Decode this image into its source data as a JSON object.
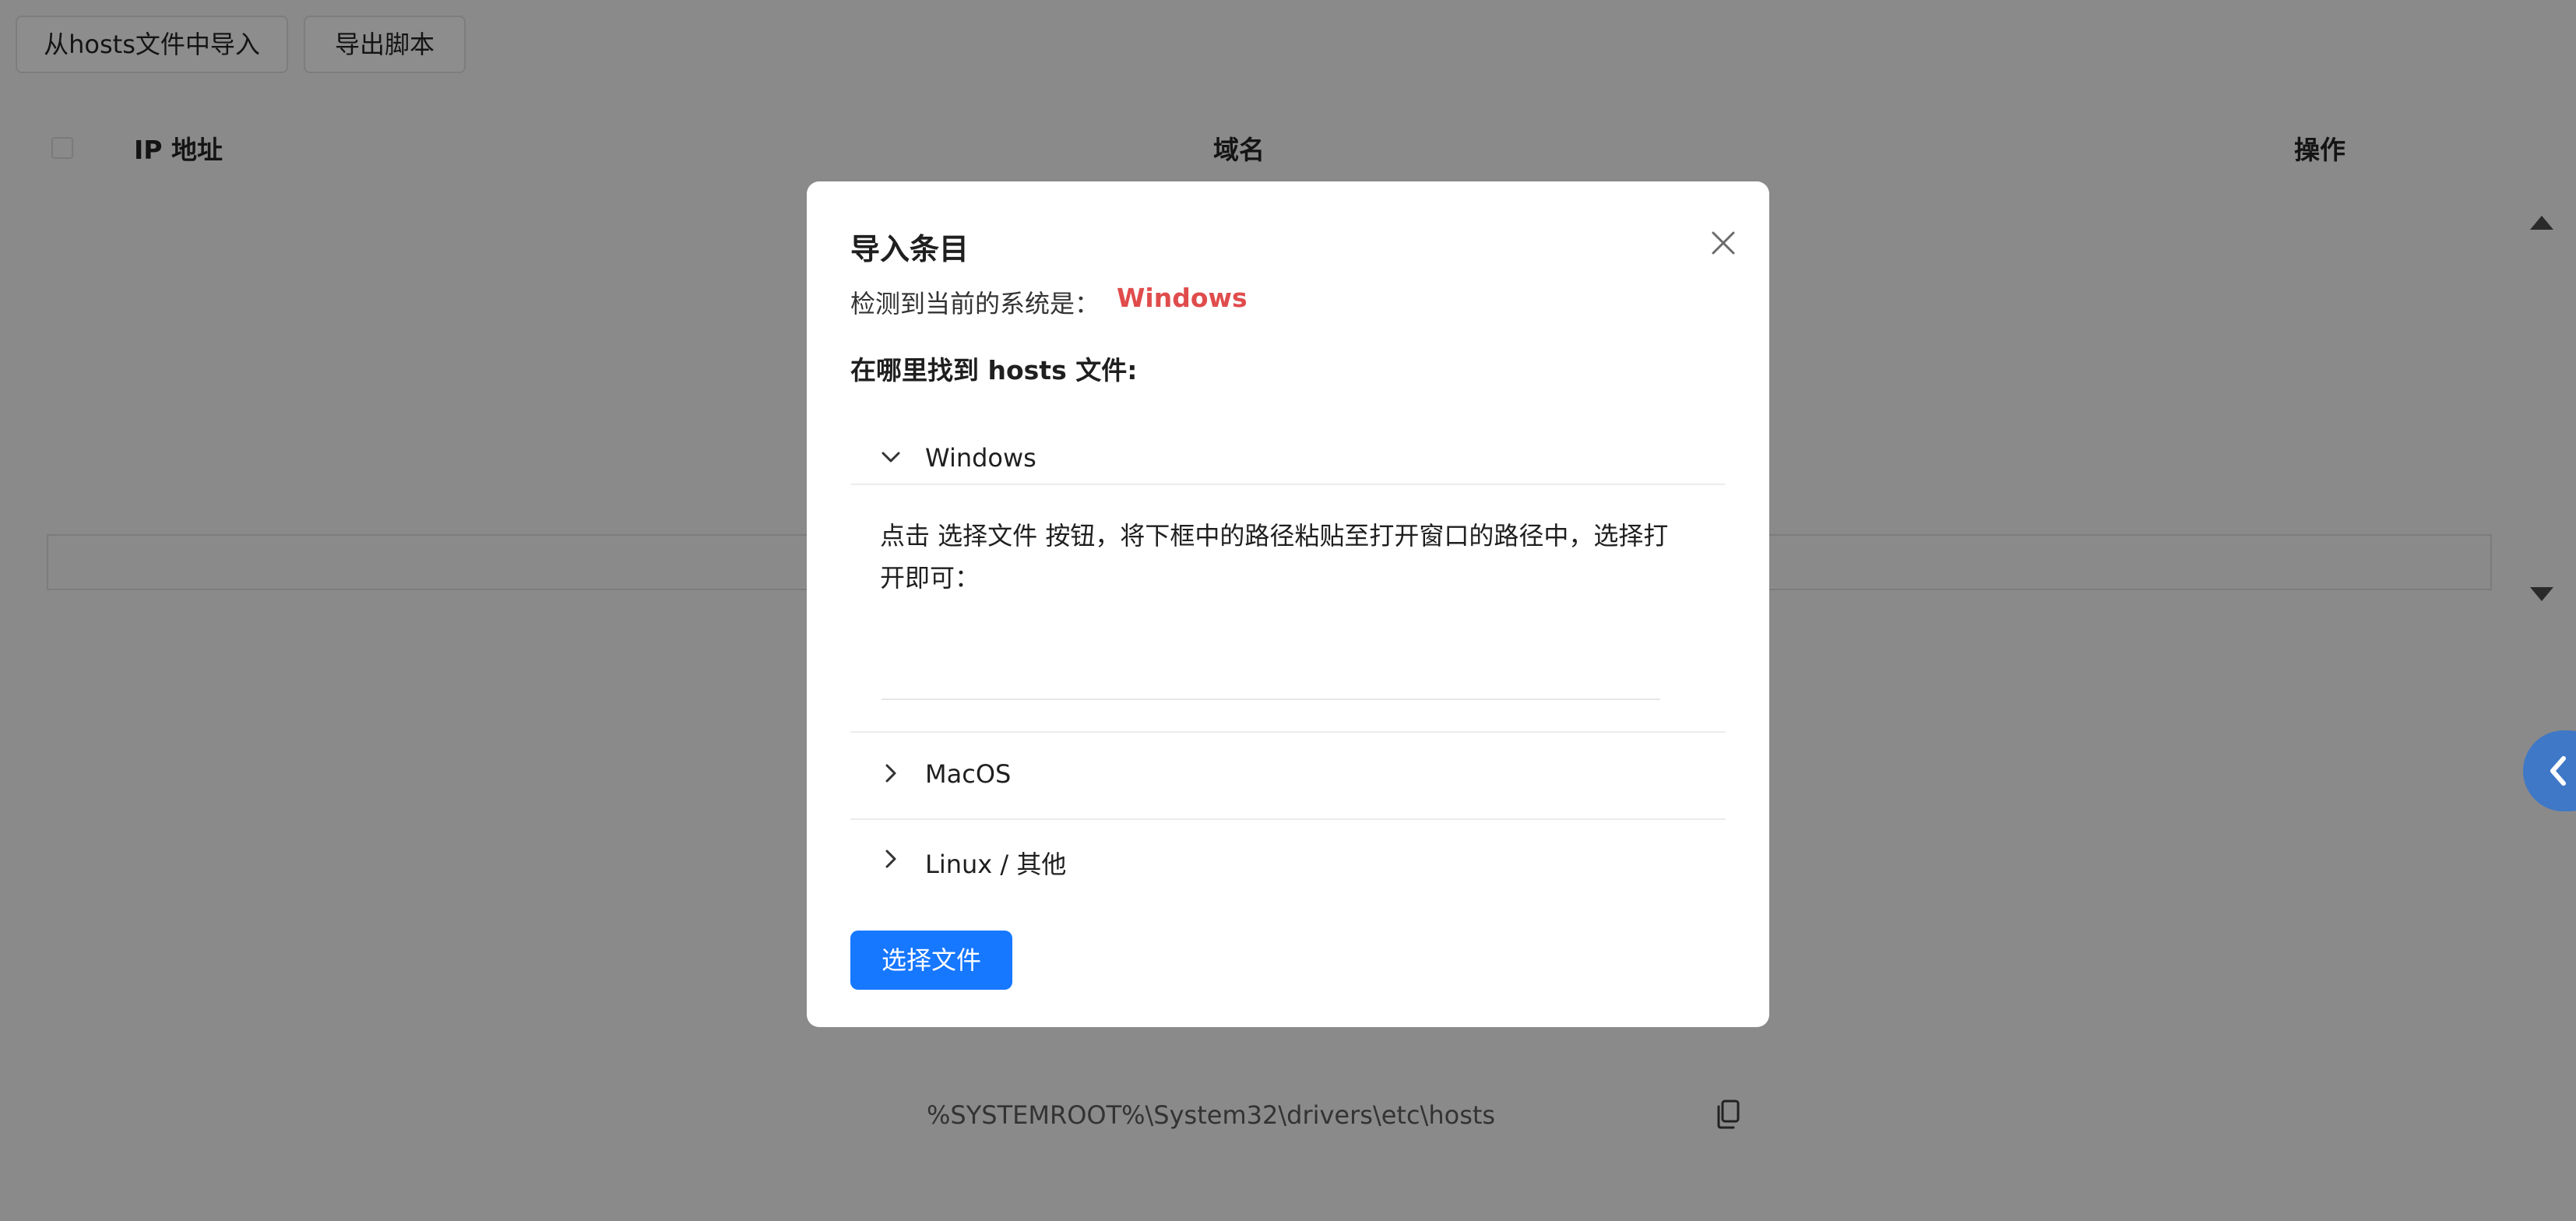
{
  "toolbar": {
    "import_label": "从hosts文件中导入",
    "export_label": "导出脚本"
  },
  "table": {
    "columns": [
      "IP 地址",
      "域名",
      "操作"
    ]
  },
  "modal": {
    "title": "导入条目",
    "detect_label": "检测到当前的系统是：",
    "detect_value": "Windows",
    "where_label": "在哪里找到 hosts 文件:",
    "sections": [
      {
        "label": "Windows",
        "expanded": true
      },
      {
        "label": "MacOS",
        "expanded": false
      },
      {
        "label": "Linux / 其他",
        "expanded": false
      }
    ],
    "instruction": "点击 选择文件 按钮，将下框中的路径粘贴至打开窗口的路径中，选择打开即可：",
    "path_value": "%SYSTEMROOT%\\System32\\drivers\\etc\\hosts",
    "select_file_label": "选择文件"
  },
  "icons": {
    "close": "close-icon",
    "copy": "copy-icon",
    "chevron_down": "chevron-down-icon",
    "chevron_right": "chevron-right-icon",
    "side_tab": "chevron-left-icon"
  },
  "colors": {
    "accent": "#1677ff",
    "detect_value": "#e04c4c",
    "overlay": "#8a8a8a"
  }
}
